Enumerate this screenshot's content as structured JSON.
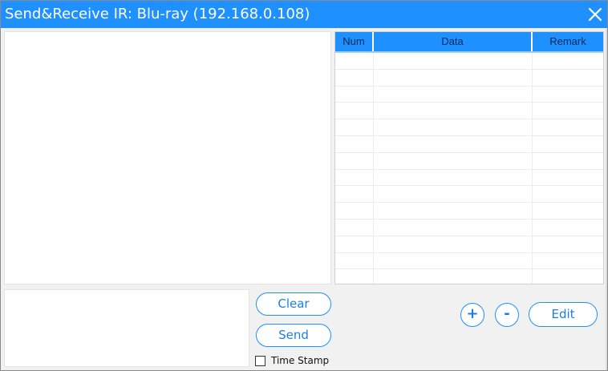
{
  "window": {
    "title": "Send&Receive IR: Blu-ray (192.168.0.108)",
    "close_icon": "close-icon",
    "accent_color": "#1e90ff"
  },
  "receive_area": {
    "value": ""
  },
  "ir_table": {
    "columns": [
      "Num",
      "Data",
      "Remark"
    ],
    "rows": [
      [
        "",
        "",
        ""
      ],
      [
        "",
        "",
        ""
      ],
      [
        "",
        "",
        ""
      ],
      [
        "",
        "",
        ""
      ],
      [
        "",
        "",
        ""
      ],
      [
        "",
        "",
        ""
      ],
      [
        "",
        "",
        ""
      ],
      [
        "",
        "",
        ""
      ],
      [
        "",
        "",
        ""
      ],
      [
        "",
        "",
        ""
      ],
      [
        "",
        "",
        ""
      ],
      [
        "",
        "",
        ""
      ],
      [
        "",
        "",
        ""
      ],
      [
        "",
        "",
        ""
      ]
    ]
  },
  "send_area": {
    "value": ""
  },
  "buttons": {
    "clear": "Clear",
    "send": "Send",
    "add": "+",
    "remove": "-",
    "edit": "Edit"
  },
  "timestamp": {
    "label": "Time Stamp",
    "checked": false
  }
}
